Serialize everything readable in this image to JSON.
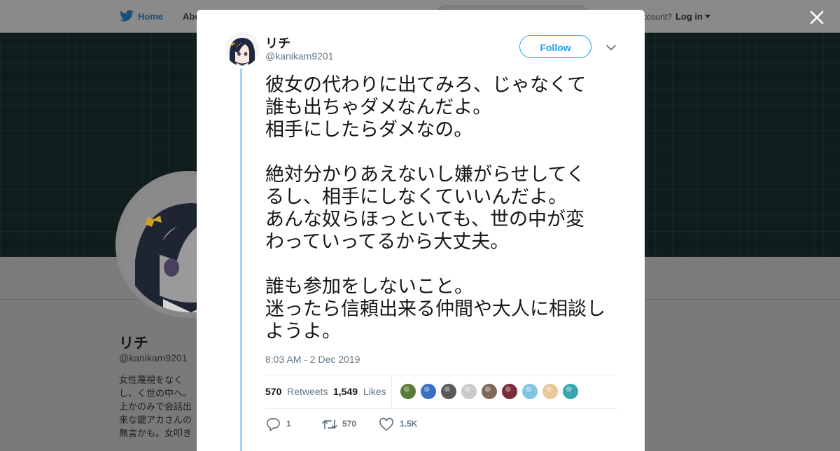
{
  "topnav": {
    "home_label": "Home",
    "about_label": "Abo",
    "account_prompt": "ccount?",
    "login_label": "Log in"
  },
  "profile_bg": {
    "name": "リチ",
    "handle": "@kanikam9201",
    "bio": "女性蔑視をなくし、く世の中へ。上かのみで会話出来な鍵アカさんの無言かも。女叩きや嫌"
  },
  "tweet": {
    "author_name": "リチ",
    "author_handle": "@kanikam9201",
    "follow_label": "Follow",
    "text": "彼女の代わりに出てみろ、じゃなくて\n誰も出ちゃダメなんだよ。\n相手にしたらダメなの。\n\n絶対分かりあえないし嫌がらせしてく\nるし、相手にしなくていいんだよ。\nあんな奴らほっといても、世の中が変\nわっていってるから大丈夫。\n\n誰も参加をしないこと。\n迷ったら信頼出来る仲間や大人に相談し\nようよ。",
    "timestamp": "8:03 AM - 2 Dec 2019",
    "retweets_count": "570",
    "retweets_label": "Retweets",
    "likes_count": "1,549",
    "likes_label": "Likes",
    "reply_count": "1",
    "retweet_action_count": "570",
    "like_action_count": "1.5K"
  },
  "likers": [
    {
      "icon": "liker-avatar-1",
      "color": "#5b7a3a"
    },
    {
      "icon": "liker-avatar-2",
      "color": "#3b6fc2"
    },
    {
      "icon": "liker-avatar-3",
      "color": "#5a5a5a"
    },
    {
      "icon": "liker-avatar-4",
      "color": "#c9c9c9"
    },
    {
      "icon": "liker-avatar-5",
      "color": "#7b6a5c"
    },
    {
      "icon": "liker-avatar-6",
      "color": "#7a2c3a"
    },
    {
      "icon": "liker-avatar-7",
      "color": "#7fc6e0"
    },
    {
      "icon": "liker-avatar-8",
      "color": "#e8c79a"
    },
    {
      "icon": "liker-avatar-9",
      "color": "#3aa6b0"
    }
  ],
  "colors": {
    "accent": "#1da1f2",
    "thread_line": "#a4d2f2",
    "text_primary": "#14171a",
    "text_secondary": "#657786"
  }
}
